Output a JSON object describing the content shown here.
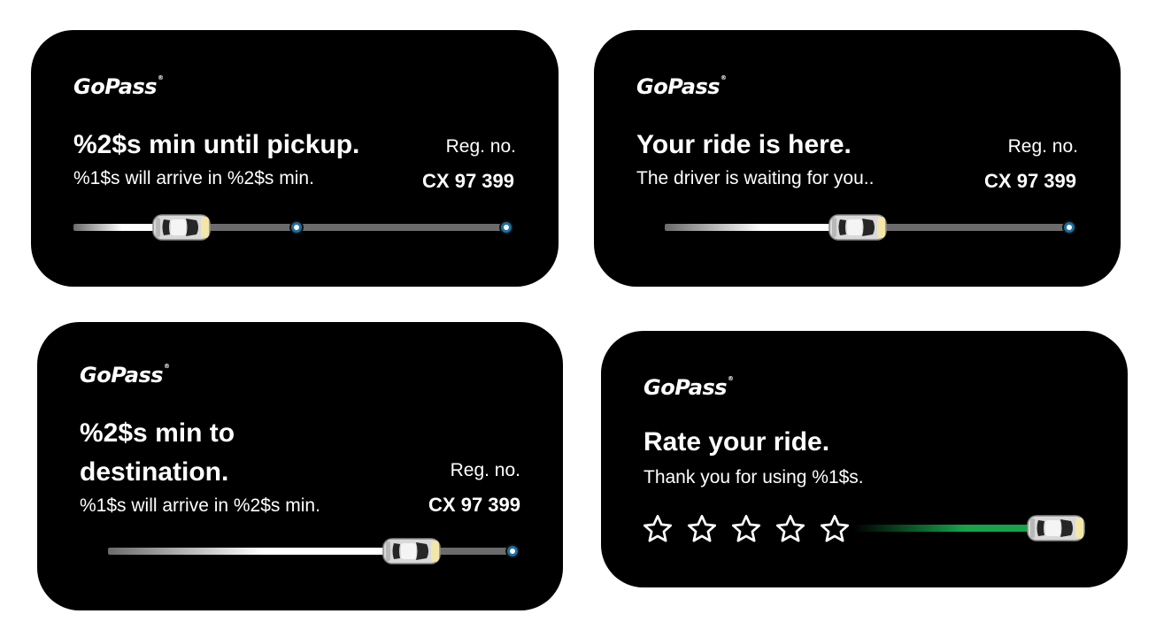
{
  "brand": {
    "logo": "GoPass",
    "trademark": "®"
  },
  "cards": [
    {
      "title": "%2$s min until pickup.",
      "subtitle": "%1$s will arrive in %2$s min.",
      "reg_label": "Reg. no.",
      "reg_value": "CX 97 399",
      "progress": 0.2
    },
    {
      "title": "Your ride is here.",
      "subtitle": "The driver is waiting for you..",
      "reg_label": "Reg. no.",
      "reg_value": "CX 97 399",
      "progress": 0.5
    },
    {
      "title_line1": "%2$s min to",
      "title_line2": "destination.",
      "subtitle": "%1$s will arrive in %2$s min.",
      "reg_label": "Reg. no.",
      "reg_value": "CX 97 399",
      "progress": 0.75
    },
    {
      "title": "Rate your ride.",
      "subtitle": "Thank you for using %1$s.",
      "rating": {
        "max": 5,
        "value": 0
      },
      "progress": 1.0
    }
  ],
  "colors": {
    "stop": "#1d6fa0",
    "track": "#6b6b6b",
    "progress_white": "#ffffff",
    "progress_green": "#16a34a"
  },
  "icons": {
    "car": "car-top-view-icon",
    "stop": "route-stop-icon",
    "star": "star-outline-icon"
  }
}
